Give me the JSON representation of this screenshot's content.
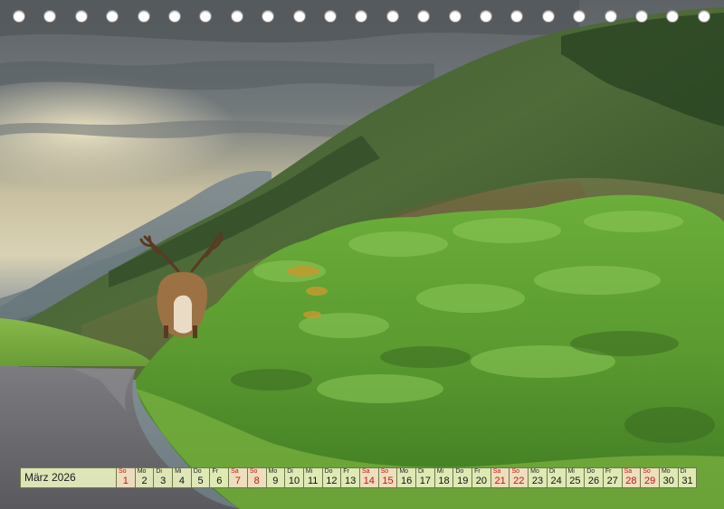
{
  "calendar": {
    "month_label": "März 2026",
    "days": [
      {
        "dow": "So",
        "num": "1",
        "weekend": true
      },
      {
        "dow": "Mo",
        "num": "2",
        "weekend": false
      },
      {
        "dow": "Di",
        "num": "3",
        "weekend": false
      },
      {
        "dow": "Mi",
        "num": "4",
        "weekend": false
      },
      {
        "dow": "Do",
        "num": "5",
        "weekend": false
      },
      {
        "dow": "Fr",
        "num": "6",
        "weekend": false
      },
      {
        "dow": "Sa",
        "num": "7",
        "weekend": true
      },
      {
        "dow": "So",
        "num": "8",
        "weekend": true
      },
      {
        "dow": "Mo",
        "num": "9",
        "weekend": false
      },
      {
        "dow": "Di",
        "num": "10",
        "weekend": false
      },
      {
        "dow": "Mi",
        "num": "11",
        "weekend": false
      },
      {
        "dow": "Do",
        "num": "12",
        "weekend": false
      },
      {
        "dow": "Fr",
        "num": "13",
        "weekend": false
      },
      {
        "dow": "Sa",
        "num": "14",
        "weekend": true
      },
      {
        "dow": "So",
        "num": "15",
        "weekend": true
      },
      {
        "dow": "Mo",
        "num": "16",
        "weekend": false
      },
      {
        "dow": "Di",
        "num": "17",
        "weekend": false
      },
      {
        "dow": "Mi",
        "num": "18",
        "weekend": false
      },
      {
        "dow": "Do",
        "num": "19",
        "weekend": false
      },
      {
        "dow": "Fr",
        "num": "20",
        "weekend": false
      },
      {
        "dow": "Sa",
        "num": "21",
        "weekend": true
      },
      {
        "dow": "So",
        "num": "22",
        "weekend": true
      },
      {
        "dow": "Mo",
        "num": "23",
        "weekend": false
      },
      {
        "dow": "Di",
        "num": "24",
        "weekend": false
      },
      {
        "dow": "Mi",
        "num": "25",
        "weekend": false
      },
      {
        "dow": "Do",
        "num": "26",
        "weekend": false
      },
      {
        "dow": "Fr",
        "num": "27",
        "weekend": false
      },
      {
        "dow": "Sa",
        "num": "28",
        "weekend": true
      },
      {
        "dow": "So",
        "num": "29",
        "weekend": true
      },
      {
        "dow": "Mo",
        "num": "30",
        "weekend": false
      },
      {
        "dow": "Di",
        "num": "31",
        "weekend": false
      }
    ]
  },
  "binding": {
    "ring_count": 23,
    "ring_icon": "binding-ring-icon"
  },
  "colors": {
    "weekend_text": "#c0180f",
    "cell_bg": "#e8f0be"
  }
}
